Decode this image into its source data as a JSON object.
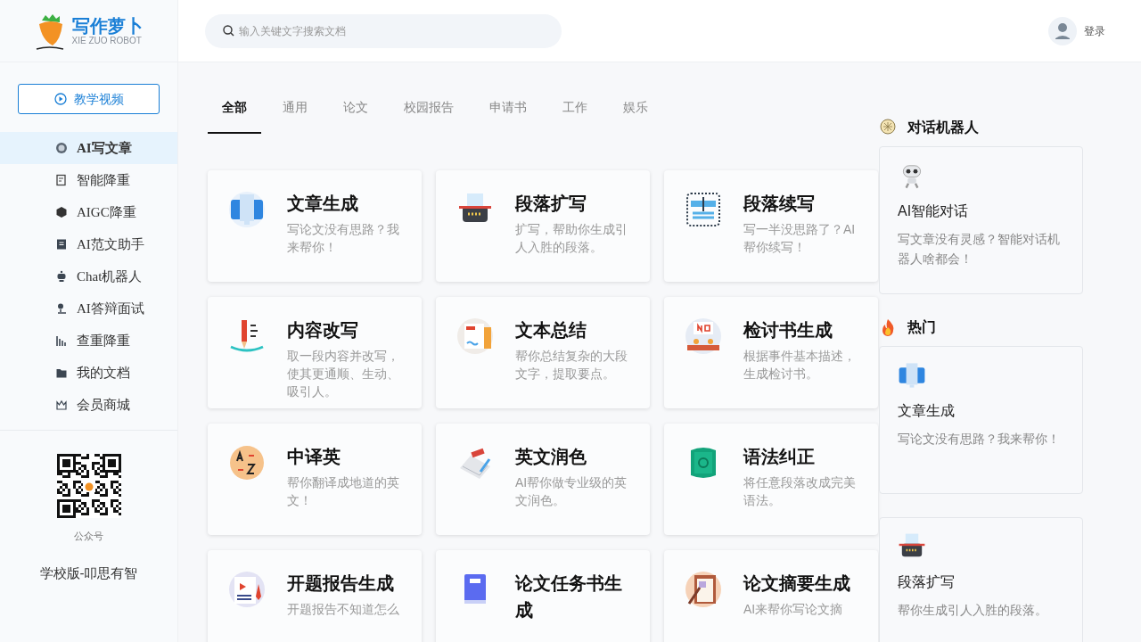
{
  "logo": {
    "title": "写作萝卜",
    "subtitle": "XIE ZUO ROBOT"
  },
  "search": {
    "placeholder": "输入关键文字搜索文档"
  },
  "user": {
    "label": "登录"
  },
  "tutorial_button": {
    "label": "教学视频"
  },
  "sidebar": {
    "items": [
      {
        "label": "AI写文章",
        "selected": true
      },
      {
        "label": "智能降重",
        "selected": false
      },
      {
        "label": "AIGC降重",
        "selected": false
      },
      {
        "label": "AI范文助手",
        "selected": false
      },
      {
        "label": "Chat机器人",
        "selected": false
      },
      {
        "label": "AI答辩面试",
        "selected": false
      },
      {
        "label": "查重降重",
        "selected": false
      },
      {
        "label": "我的文档",
        "selected": false
      },
      {
        "label": "会员商城",
        "selected": false
      }
    ]
  },
  "qr": {
    "caption": "公众号"
  },
  "school_version": "学校版-叩思有智",
  "tabs": [
    {
      "label": "全部",
      "selected": true
    },
    {
      "label": "通用",
      "selected": false
    },
    {
      "label": "论文",
      "selected": false
    },
    {
      "label": "校园报告",
      "selected": false
    },
    {
      "label": "申请书",
      "selected": false
    },
    {
      "label": "工作",
      "selected": false
    },
    {
      "label": "娱乐",
      "selected": false
    }
  ],
  "cards": [
    {
      "title": "文章生成",
      "description": "写论文没有思路？我来帮你！"
    },
    {
      "title": "段落扩写",
      "description": "扩写，帮助你生成引人入胜的段落。"
    },
    {
      "title": "段落续写",
      "description": "写一半没思路了？AI帮你续写！"
    },
    {
      "title": "内容改写",
      "description": "取一段内容并改写，使其更通顺、生动、吸引人。"
    },
    {
      "title": "文本总结",
      "description": "帮你总结复杂的大段文字，提取要点。"
    },
    {
      "title": "检讨书生成",
      "description": "根据事件基本描述，生成检讨书。"
    },
    {
      "title": "中译英",
      "description": "帮你翻译成地道的英文！"
    },
    {
      "title": "英文润色",
      "description": "AI帮你做专业级的英文润色。"
    },
    {
      "title": "语法纠正",
      "description": "将任意段落改成完美语法。"
    },
    {
      "title": "开题报告生成",
      "description": "开题报告不知道怎么"
    },
    {
      "title": "论文任务书生成"
    },
    {
      "title": "论文摘要生成",
      "description": "AI来帮你写论文摘"
    }
  ],
  "right_panel": {
    "sections": [
      {
        "heading": "对话机器人",
        "items": [
          {
            "title": "AI智能对话",
            "description": "写文章没有灵感？智能对话机器人啥都会！"
          }
        ]
      },
      {
        "heading": "热门",
        "items": [
          {
            "title": "文章生成",
            "description": "写论文没有思路？我来帮你！"
          },
          {
            "title": "段落扩写",
            "description": "帮你生成引人入胜的段落。"
          }
        ]
      }
    ]
  }
}
